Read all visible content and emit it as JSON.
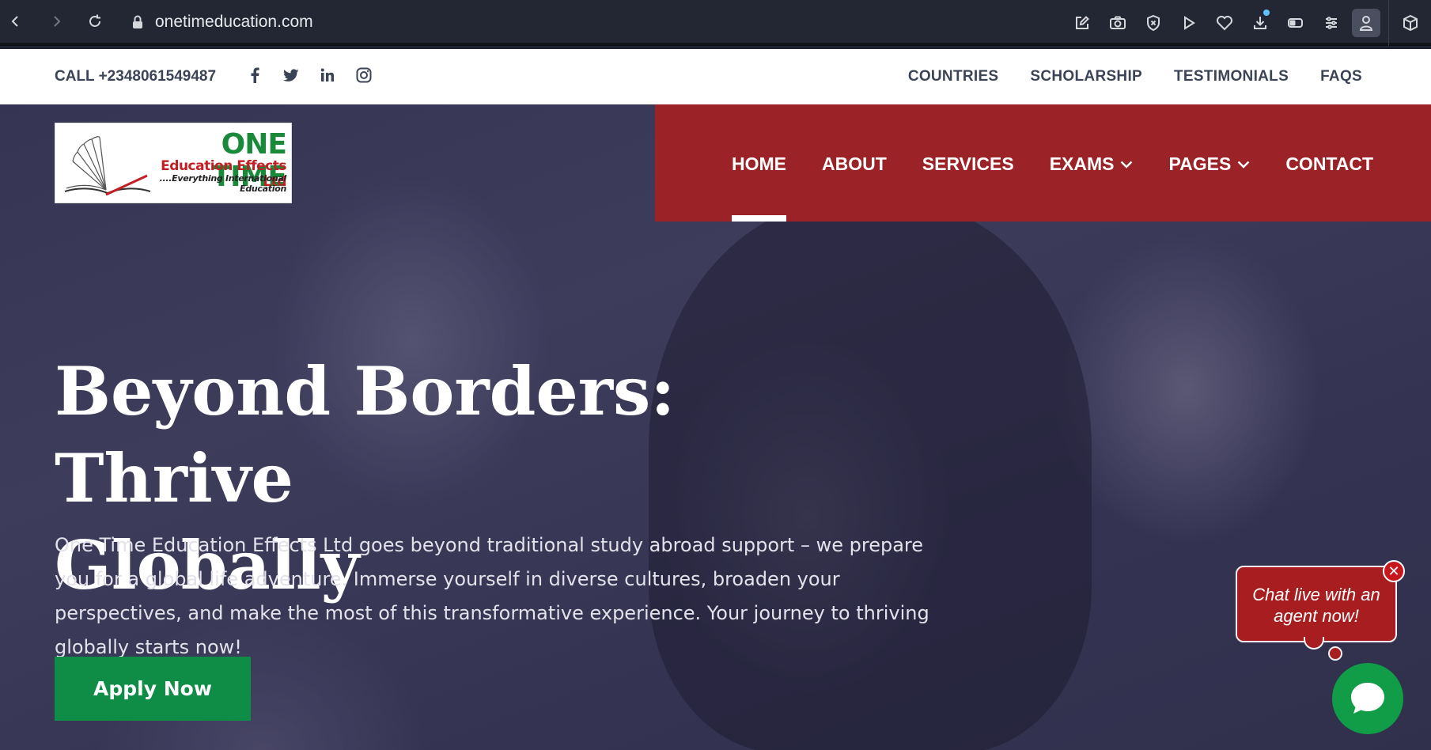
{
  "browser": {
    "url": "onetimeducation.com"
  },
  "topbar": {
    "call": "CALL +2348061549487",
    "social_icons": [
      "facebook-icon",
      "twitter-icon",
      "linkedin-icon",
      "instagram-icon"
    ],
    "links": [
      "COUNTRIES",
      "SCHOLARSHIP",
      "TESTIMONIALS",
      "FAQS"
    ]
  },
  "logo": {
    "line1": "ONE TIME",
    "line2": "Education Effects Ltd",
    "line3": "....Everything International Education"
  },
  "nav": {
    "items": [
      {
        "label": "HOME",
        "active": true,
        "dropdown": false
      },
      {
        "label": "ABOUT",
        "active": false,
        "dropdown": false
      },
      {
        "label": "SERVICES",
        "active": false,
        "dropdown": false
      },
      {
        "label": "EXAMS",
        "active": false,
        "dropdown": true
      },
      {
        "label": "PAGES",
        "active": false,
        "dropdown": true
      },
      {
        "label": "CONTACT",
        "active": false,
        "dropdown": false
      }
    ]
  },
  "hero": {
    "headline_line1": "Beyond Borders: Thrive",
    "headline_line2": "Globally",
    "lead": "One Time Education Effects Ltd goes beyond traditional study abroad support – we prepare you for a global life adventure. Immerse yourself in diverse cultures, broaden your perspectives, and make the most of this transformative experience. Your journey to thriving globally starts now!",
    "cta": "Apply Now"
  },
  "chat": {
    "line1": "Chat live with an",
    "line2": "agent now!",
    "close": "✕"
  },
  "colors": {
    "nav_red": "#9b2226",
    "cta_green": "#0f8c46",
    "chat_red": "#a81e20",
    "chat_green": "#119d48"
  }
}
